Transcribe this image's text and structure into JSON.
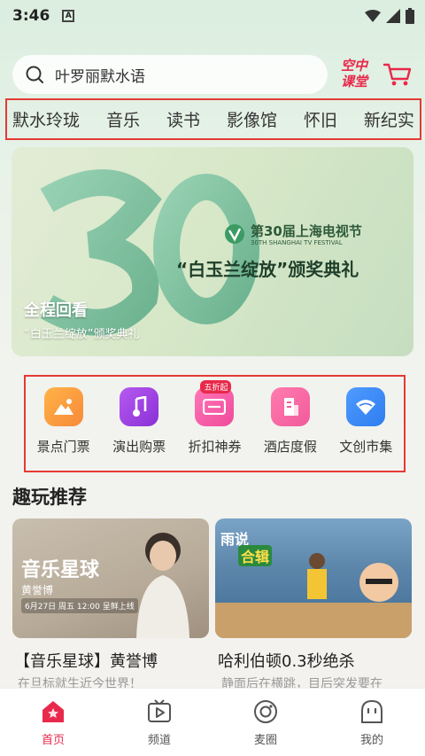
{
  "status_bar": {
    "time": "3:46",
    "notification_letter": "A"
  },
  "search": {
    "placeholder": "叶罗丽默水语"
  },
  "header": {
    "air_class_line1": "空中",
    "air_class_line2": "课堂"
  },
  "nav_tabs": [
    {
      "label": "默水玲珑"
    },
    {
      "label": "音乐"
    },
    {
      "label": "读书"
    },
    {
      "label": "影像馆"
    },
    {
      "label": "怀旧"
    },
    {
      "label": "新纪实"
    }
  ],
  "banner": {
    "festival_name": "第30届上海电视节",
    "festival_name_en": "30TH SHANGHAI TV FESTIVAL",
    "headline": "“白玉兰绽放”颁奖典礼",
    "caption_main": "全程回看",
    "caption_sub": "“白玉兰绽放”颁奖典礼"
  },
  "quick_links": [
    {
      "label": "景点门票",
      "icon": "mountain-ticket-icon",
      "color": "#f7a23a"
    },
    {
      "label": "演出购票",
      "icon": "music-note-icon",
      "color": "#9b3fe0"
    },
    {
      "label": "折扣神券",
      "icon": "coupon-icon",
      "color": "#f04a9b",
      "badge": "五折起"
    },
    {
      "label": "酒店度假",
      "icon": "hotel-icon",
      "color": "#f25a9c"
    },
    {
      "label": "文创市集",
      "icon": "fan-icon",
      "color": "#2f7cf0"
    }
  ],
  "section": {
    "title": "趣玩推荐"
  },
  "cards": [
    {
      "title": "【音乐星球】黄誉博",
      "subtitle": "在旦标就生近今世界！",
      "image_title": "音乐星球",
      "image_name": "黄誉博",
      "image_time": "6月27日 周五 12:00 呈鲜上线"
    },
    {
      "title": "哈利伯顿0.3秒绝杀",
      "subtitle": "静面后在横跳，目后突发要在",
      "image_badge1": "雨说",
      "image_badge2": "合辑"
    }
  ],
  "bottom_nav": [
    {
      "label": "首页",
      "icon": "home-icon",
      "active": true
    },
    {
      "label": "频道",
      "icon": "tv-play-icon",
      "active": false
    },
    {
      "label": "麦圈",
      "icon": "circle-icon",
      "active": false
    },
    {
      "label": "我的",
      "icon": "profile-icon",
      "active": false
    }
  ],
  "colors": {
    "accent": "#e8294b",
    "highlight_border": "#e53935"
  }
}
